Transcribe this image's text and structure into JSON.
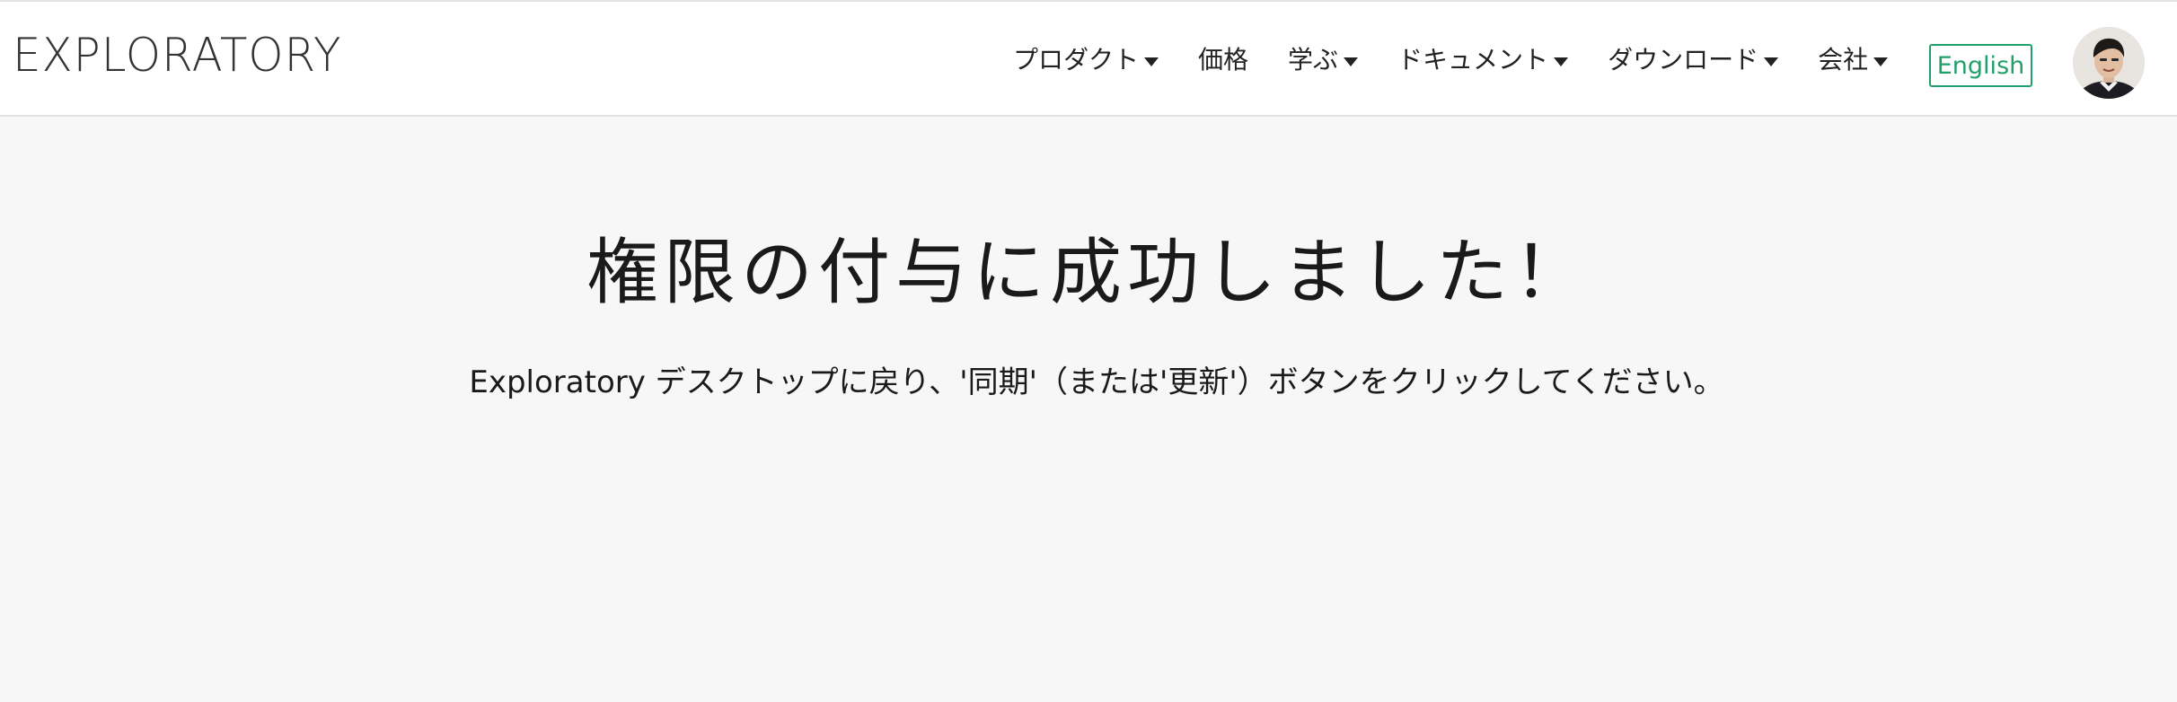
{
  "header": {
    "logo": "EXPLORATORY",
    "nav": [
      {
        "label": "プロダクト",
        "has_dropdown": true
      },
      {
        "label": "価格",
        "has_dropdown": false
      },
      {
        "label": "学ぶ",
        "has_dropdown": true
      },
      {
        "label": "ドキュメント",
        "has_dropdown": true
      },
      {
        "label": "ダウンロード",
        "has_dropdown": true
      },
      {
        "label": "会社",
        "has_dropdown": true
      }
    ],
    "language_button": "English",
    "avatar_icon": "user-avatar-icon"
  },
  "main": {
    "title": "権限の付与に成功しました！",
    "message": "Exploratory デスクトップに戻り、'同期'（または'更新'）ボタンをクリックしてください。"
  },
  "colors": {
    "header_background": "#ffffff",
    "page_background": "#f7f7f7",
    "accent_green": "#22a06b",
    "text": "#1a1a1a"
  }
}
